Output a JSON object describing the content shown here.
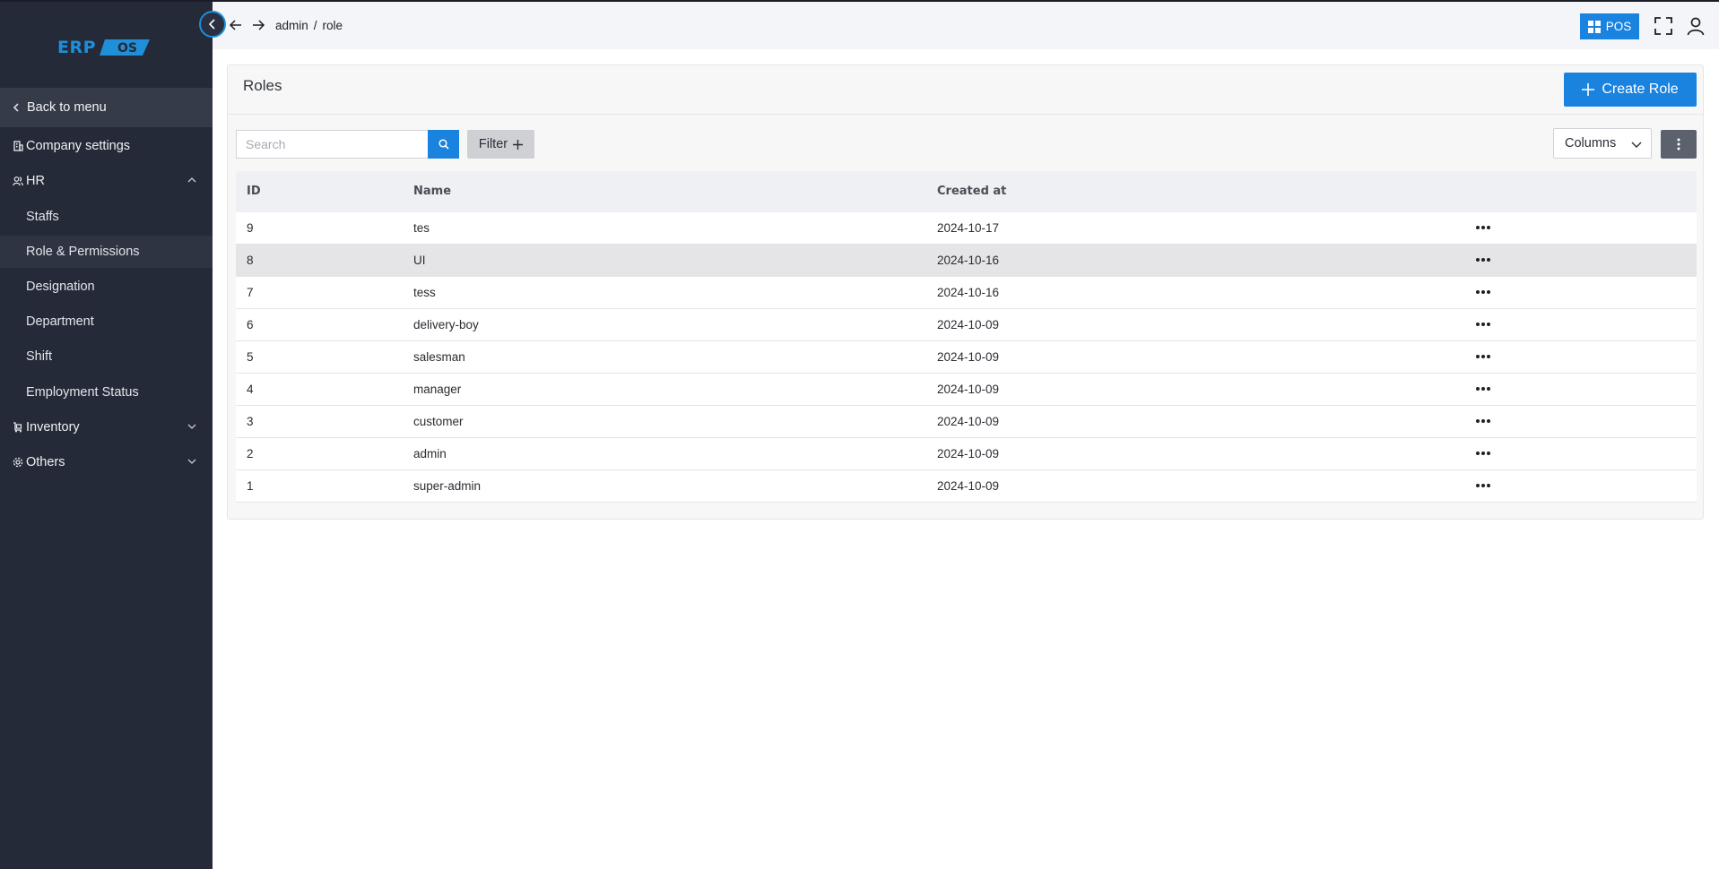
{
  "logo": {
    "erp": "ERP",
    "os": "OS"
  },
  "sidebar": {
    "back_label": "Back to menu",
    "items": [
      {
        "label": "Company settings",
        "icon": "building-icon"
      },
      {
        "label": "HR",
        "icon": "users-icon",
        "expanded": true
      },
      {
        "label": "Inventory",
        "icon": "inventory-icon",
        "expanded": false
      },
      {
        "label": "Others",
        "icon": "gear-icon",
        "expanded": false
      }
    ],
    "hr_sub": [
      {
        "label": "Staffs"
      },
      {
        "label": "Role & Permissions",
        "active": true
      },
      {
        "label": "Designation"
      },
      {
        "label": "Department"
      },
      {
        "label": "Shift"
      },
      {
        "label": "Employment Status"
      }
    ]
  },
  "topbar": {
    "breadcrumb": [
      "admin",
      "role"
    ],
    "breadcrumb_sep": "/",
    "pos_label": "POS"
  },
  "page": {
    "title": "Roles",
    "create_label": "Create Role",
    "search_placeholder": "Search",
    "filter_label": "Filter",
    "columns_label": "Columns"
  },
  "table": {
    "headers": {
      "id": "ID",
      "name": "Name",
      "created": "Created at"
    },
    "rows": [
      {
        "id": "9",
        "name": "tes",
        "created": "2024-10-17"
      },
      {
        "id": "8",
        "name": "UI",
        "created": "2024-10-16"
      },
      {
        "id": "7",
        "name": "tess",
        "created": "2024-10-16"
      },
      {
        "id": "6",
        "name": "delivery-boy",
        "created": "2024-10-09"
      },
      {
        "id": "5",
        "name": "salesman",
        "created": "2024-10-09"
      },
      {
        "id": "4",
        "name": "manager",
        "created": "2024-10-09"
      },
      {
        "id": "3",
        "name": "customer",
        "created": "2024-10-09"
      },
      {
        "id": "2",
        "name": "admin",
        "created": "2024-10-09"
      },
      {
        "id": "1",
        "name": "super-admin",
        "created": "2024-10-09"
      }
    ]
  },
  "colors": {
    "accent": "#1a83e0",
    "sidebar_bg": "#252a38"
  }
}
